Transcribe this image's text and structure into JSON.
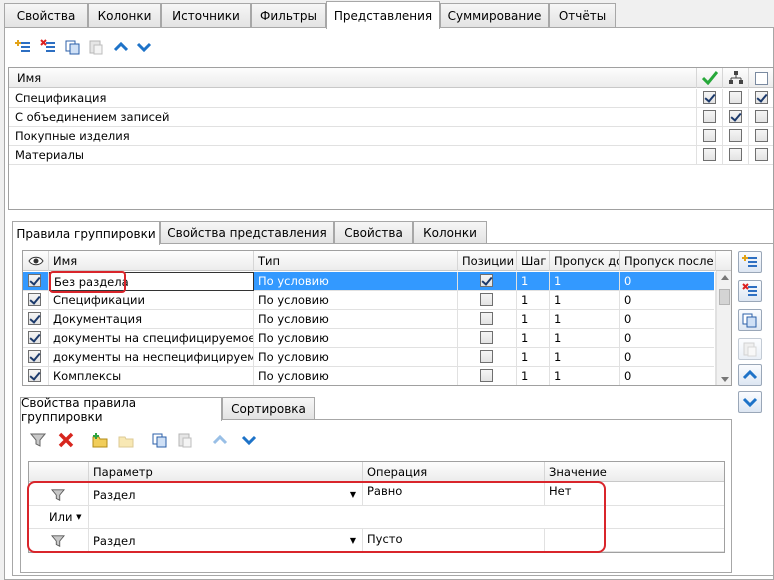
{
  "top_tabs": [
    "Свойства",
    "Колонки",
    "Источники",
    "Фильтры",
    "Представления",
    "Суммирование",
    "Отчёты"
  ],
  "top_tab_active": "Представления",
  "views_grid": {
    "header_name": "Имя",
    "rows": [
      {
        "name": "Спецификация",
        "c1": true,
        "c2": false,
        "c3": true
      },
      {
        "name": "С объединением записей",
        "c1": false,
        "c2": true,
        "c3": false
      },
      {
        "name": "Покупные изделия",
        "c1": false,
        "c2": false,
        "c3": false
      },
      {
        "name": "Материалы",
        "c1": false,
        "c2": false,
        "c3": false
      }
    ]
  },
  "mid_tabs": [
    "Правила группировки",
    "Свойства представления",
    "Свойства",
    "Колонки"
  ],
  "rules_grid": {
    "headers": {
      "name": "Имя",
      "type": "Тип",
      "positions": "Позиции",
      "step": "Шаг",
      "skip_before": "Пропуск до",
      "skip_after": "Пропуск после"
    },
    "rows": [
      {
        "checked": true,
        "name": "Без раздела",
        "type": "По условию",
        "positions": true,
        "step": "1",
        "skip_before": "1",
        "skip_after": "0"
      },
      {
        "checked": true,
        "name": "Спецификации",
        "type": "По условию",
        "positions": false,
        "step": "1",
        "skip_before": "1",
        "skip_after": "0"
      },
      {
        "checked": true,
        "name": "Документация",
        "type": "По условию",
        "positions": false,
        "step": "1",
        "skip_before": "1",
        "skip_after": "0"
      },
      {
        "checked": true,
        "name": "документы на специфицируемое из",
        "type": "По условию",
        "positions": false,
        "step": "1",
        "skip_before": "1",
        "skip_after": "0"
      },
      {
        "checked": true,
        "name": "документы на неспецифицируемое",
        "type": "По условию",
        "positions": false,
        "step": "1",
        "skip_before": "1",
        "skip_after": "0"
      },
      {
        "checked": true,
        "name": "Комплексы",
        "type": "По условию",
        "positions": false,
        "step": "1",
        "skip_before": "1",
        "skip_after": "0"
      }
    ]
  },
  "bottom_tabs": [
    "Свойства правила группировки",
    "Сортировка"
  ],
  "conditions_grid": {
    "headers": {
      "param": "Параметр",
      "operation": "Операция",
      "value": "Значение"
    },
    "rows": [
      {
        "param": "Раздел",
        "operation": "Равно",
        "value": "Нет"
      },
      {
        "logic": "Или"
      },
      {
        "param": "Раздел",
        "operation": "Пусто",
        "value": ""
      }
    ]
  },
  "colors": {
    "selection": "#3399ff",
    "highlight_box": "#d9252b",
    "accent_blue": "#1e73c8"
  }
}
